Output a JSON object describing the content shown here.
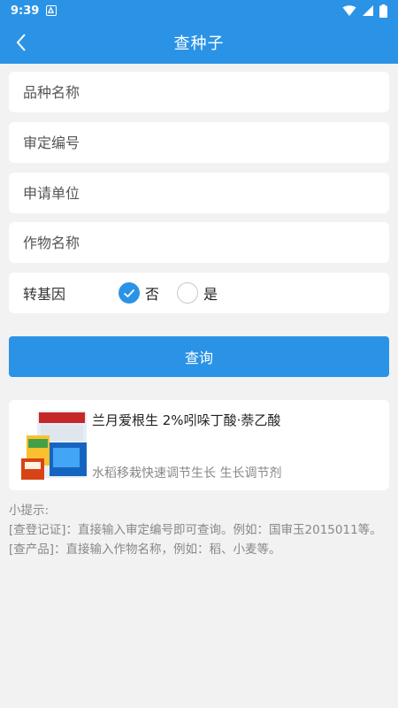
{
  "status_bar": {
    "time": "9:39",
    "icons": [
      "notification-icon",
      "wifi-icon",
      "signal-icon",
      "battery-icon"
    ]
  },
  "app_bar": {
    "title": "查种子",
    "back_icon": "chevron-left-icon"
  },
  "form": {
    "variety_placeholder": "品种名称",
    "approval_placeholder": "审定编号",
    "applicant_placeholder": "申请单位",
    "crop_placeholder": "作物名称",
    "gmo": {
      "label": "转基因",
      "options": [
        {
          "label": "否",
          "checked": true
        },
        {
          "label": "是",
          "checked": false
        }
      ]
    },
    "submit_label": "查询"
  },
  "result": {
    "name": "兰月爱根生 2%吲哚丁酸·萘乙酸",
    "description": "水稻移栽快速调节生长 生长调节剂"
  },
  "tips": {
    "title": "小提示:",
    "lines": [
      "[查登记证]：直接输入审定编号即可查询。例如：国审玉2015011等。",
      "[查产品]：直接输入作物名称，例如：稻、小麦等。"
    ]
  },
  "colors": {
    "primary": "#2b93e6",
    "background": "#f2f2f2",
    "hint_text": "#888888"
  }
}
